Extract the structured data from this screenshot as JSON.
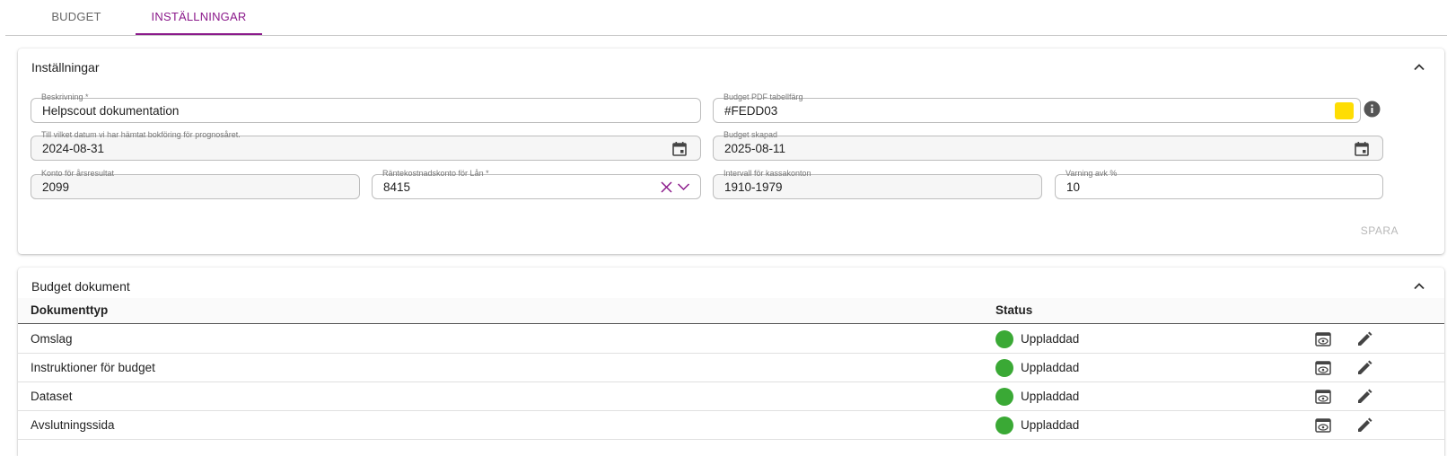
{
  "tabs": [
    {
      "label": "BUDGET",
      "active": false
    },
    {
      "label": "INSTÄLLNINGAR",
      "active": true
    }
  ],
  "settings": {
    "title": "Inställningar",
    "fields": {
      "beskrivning": {
        "label": "Beskrivning *",
        "value": "Helpscout dokumentation"
      },
      "pdf_color": {
        "label": "Budget PDF tabellfärg",
        "value": "#FEDD03",
        "swatch_color": "#FEDD03"
      },
      "bokforing_datum": {
        "label": "Till vilket datum vi har hämtat bokföring för prognosåret.",
        "value": "2024-08-31"
      },
      "budget_skapad": {
        "label": "Budget skapad",
        "value": "2025-08-11"
      },
      "konto_arsresultat": {
        "label": "Konto för årsresultat",
        "value": "2099"
      },
      "rantekostnadskonto": {
        "label": "Räntekostnadskonto för Lån *",
        "value": "8415"
      },
      "intervall_kassakonton": {
        "label": "Intervall för kassakonton",
        "value": "1910-1979"
      },
      "varning": {
        "label": "Varning avk %",
        "value": "10"
      }
    },
    "save_label": "SPARA"
  },
  "documents": {
    "title": "Budget dokument",
    "columns": {
      "type": "Dokumenttyp",
      "status": "Status"
    },
    "rows": [
      {
        "type": "Omslag",
        "status": "Uppladdad"
      },
      {
        "type": "Instruktioner för budget",
        "status": "Uppladdad"
      },
      {
        "type": "Dataset",
        "status": "Uppladdad"
      },
      {
        "type": "Avslutningssida",
        "status": "Uppladdad"
      }
    ]
  },
  "colors": {
    "accent": "#8b1a8b",
    "status_ok": "#3aa935"
  },
  "icons": [
    "chevron-up-icon",
    "info-icon",
    "calendar-icon",
    "clear-icon",
    "chevron-down-icon",
    "eye-icon",
    "pencil-icon"
  ]
}
